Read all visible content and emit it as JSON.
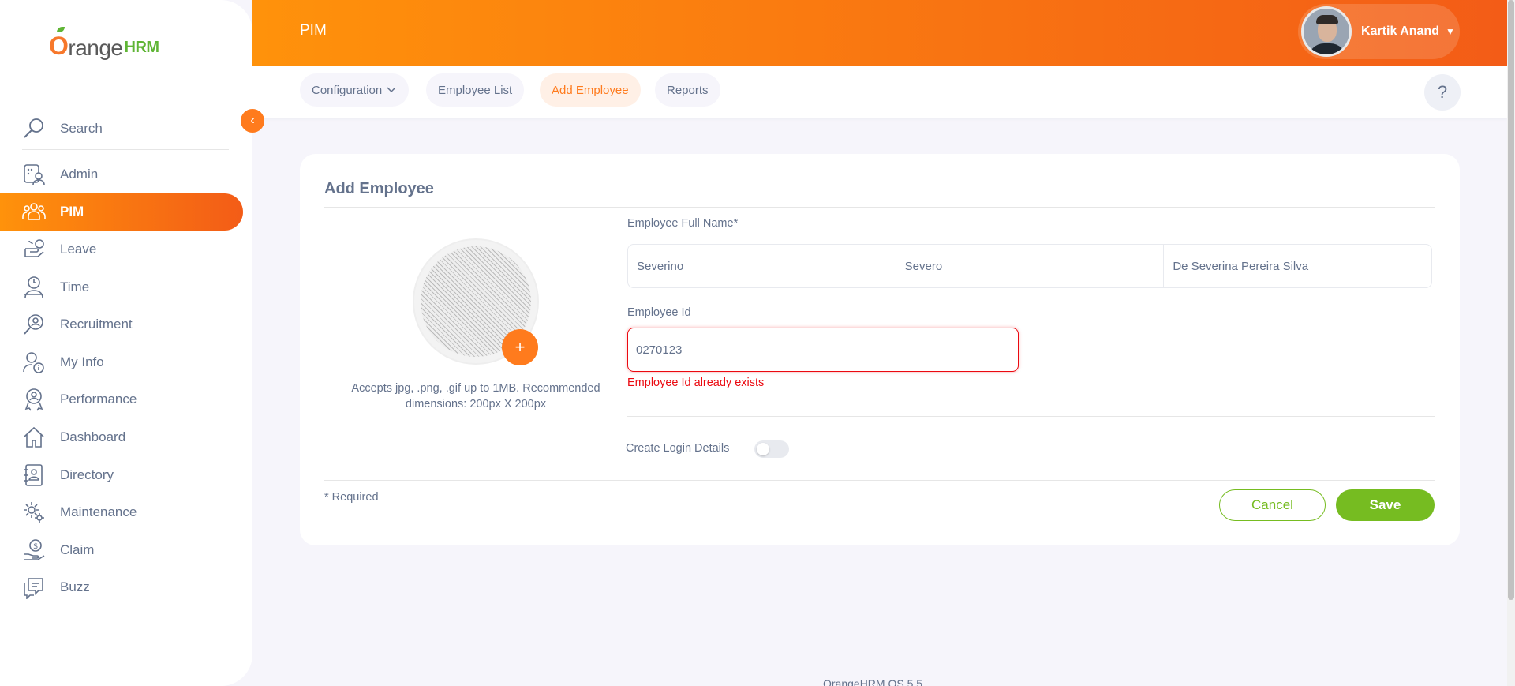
{
  "brand": {
    "logo_o": "O",
    "logo_range": "range",
    "logo_hrm": "HRM"
  },
  "sidebar": {
    "search_placeholder": "Search",
    "items": [
      {
        "label": "Admin"
      },
      {
        "label": "PIM"
      },
      {
        "label": "Leave"
      },
      {
        "label": "Time"
      },
      {
        "label": "Recruitment"
      },
      {
        "label": "My Info"
      },
      {
        "label": "Performance"
      },
      {
        "label": "Dashboard"
      },
      {
        "label": "Directory"
      },
      {
        "label": "Maintenance"
      },
      {
        "label": "Claim"
      },
      {
        "label": "Buzz"
      }
    ],
    "active_item": "PIM"
  },
  "header": {
    "module_title": "PIM",
    "user_name": "Kartik Anand",
    "help_label": "?"
  },
  "subnav": {
    "tabs": [
      {
        "label": "Configuration"
      },
      {
        "label": "Employee List"
      },
      {
        "label": "Add Employee"
      },
      {
        "label": "Reports"
      }
    ],
    "active_tab": "Add Employee"
  },
  "form": {
    "title": "Add Employee",
    "photo_hint": "Accepts jpg, .png, .gif up to 1MB. Recommended dimensions: 200px X 200px",
    "full_name_label": "Employee Full Name*",
    "first_name": "Severino",
    "middle_name": "Severo",
    "last_name": "De Severina Pereira Silva",
    "employee_id_label": "Employee Id",
    "employee_id": "0270123",
    "employee_id_error": "Employee Id already exists",
    "create_login_label": "Create Login Details",
    "create_login_enabled": false,
    "required_note": "* Required",
    "cancel_label": "Cancel",
    "save_label": "Save"
  },
  "footer": {
    "version": "OrangeHRM OS 5.5"
  },
  "colors": {
    "accent": "#ff7b1d",
    "save_green": "#76bc21",
    "error": "#eb0910"
  }
}
